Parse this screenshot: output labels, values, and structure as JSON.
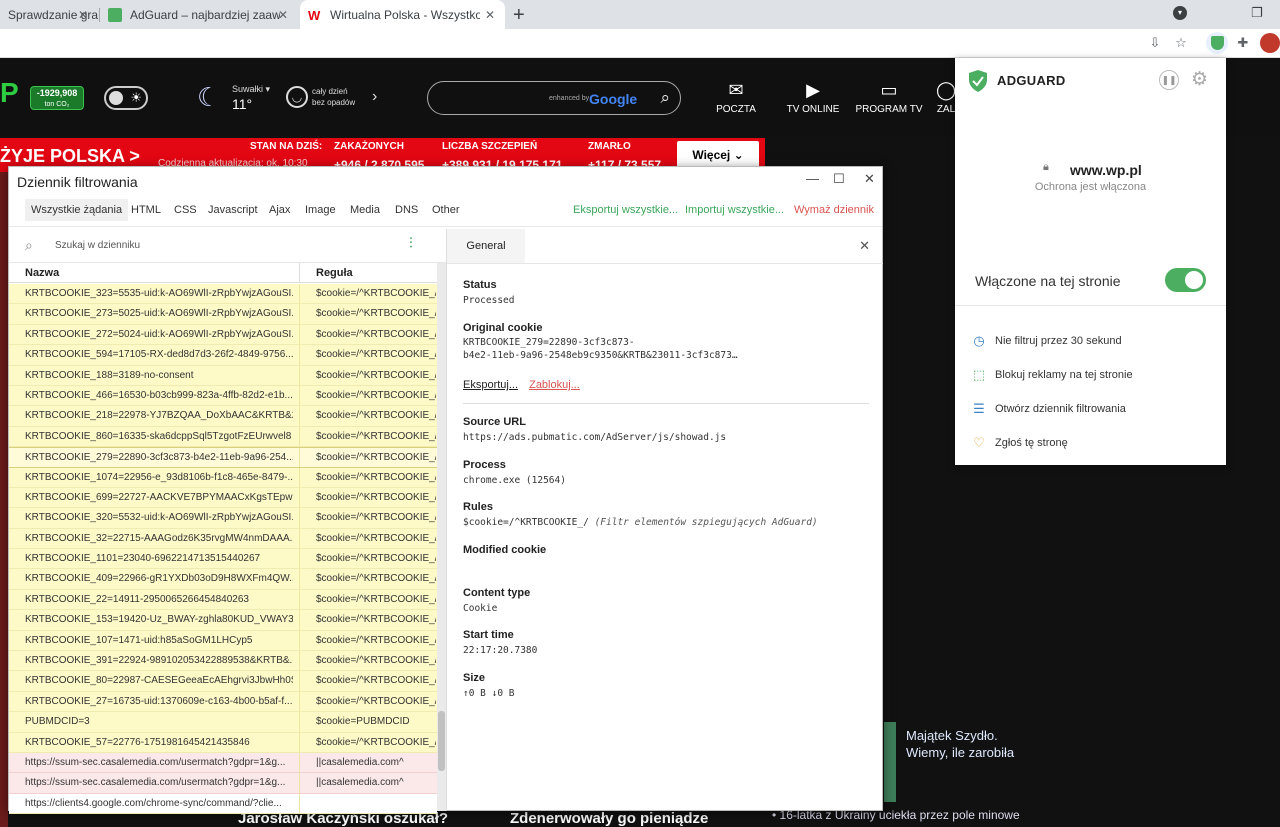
{
  "browser": {
    "tabs": [
      {
        "label": "Sprawdzanie gra",
        "active": false
      },
      {
        "label": "AdGuard – najbardziej zaawanso",
        "active": false
      },
      {
        "label": "Wirtualna Polska - Wszystko co w",
        "active": true
      }
    ],
    "new_tab": "+",
    "close_glyph": "✕"
  },
  "wp": {
    "co2_value": "-1929,908",
    "co2_unit": "ton CO₂",
    "weather_city": "Suwałki ▾",
    "weather_temp": "11°",
    "weather_desc_line1": "cały dzień",
    "weather_desc_line2": "bez opadów",
    "search_enhanced": "enhanced by",
    "search_brand": "Google",
    "nav": [
      {
        "icon": "✉",
        "label": "POCZTA"
      },
      {
        "icon": "▶",
        "label": "TV ONLINE"
      },
      {
        "icon": "▭",
        "label": "PROGRAM TV"
      },
      {
        "icon": "◯",
        "label": "ZAL"
      }
    ],
    "red_bar": {
      "title": "ŻYJE POLSKA >",
      "sub": "Codzienna aktualizacja: ok. 10:30",
      "stat1": "STAN NA DZIŚ:",
      "stat2": "ZAKAŻONYCH",
      "stat2_value": "+946 / 2 870 595",
      "stat3": "LICZBA SZCZEPIEŃ",
      "stat3_value": "+389 931 / 19 175 171",
      "stat4": "ZMARŁO",
      "stat4_value": "+117 / 73 557",
      "more_label": "Więcej ⌄"
    },
    "news_title_line1": "Majątek Szydło.",
    "news_title_line2": "Wiemy, ile zarobiła",
    "bullet": "• 16-latka z Ukrainy uciekła przez pole minowe",
    "bottom1": "Jarosław Kaczyński oszukał?",
    "bottom2": "Zdenerwowały go pieniądze"
  },
  "log": {
    "title": "Dziennik filtrowania",
    "win_controls": [
      "—",
      "☐",
      "✕"
    ],
    "tabs": [
      "Wszystkie żądania",
      "HTML",
      "CSS",
      "Javascript",
      "Ajax",
      "Image",
      "Media",
      "DNS",
      "Other"
    ],
    "actions": {
      "export_all": "Eksportuj wszystkie...",
      "import_all": "Importuj wszystkie...",
      "clear_log": "Wymaż dziennik"
    },
    "search_placeholder": "Szukaj w dzienniku",
    "col_name": "Nazwa",
    "col_rule": "Reguła",
    "rows": [
      {
        "name": "KRTBCOOKIE_323=5535-uid:k-AO69WlI-zRpbYwjzAGouSI...",
        "rule": "$cookie=/^KRTBCOOKIE_/",
        "kind": "yellow"
      },
      {
        "name": "KRTBCOOKIE_273=5025-uid:k-AO69WlI-zRpbYwjzAGouSI...",
        "rule": "$cookie=/^KRTBCOOKIE_/",
        "kind": "yellow"
      },
      {
        "name": "KRTBCOOKIE_272=5024-uid:k-AO69WlI-zRpbYwjzAGouSI...",
        "rule": "$cookie=/^KRTBCOOKIE_/",
        "kind": "yellow"
      },
      {
        "name": "KRTBCOOKIE_594=17105-RX-ded8d7d3-26f2-4849-9756...",
        "rule": "$cookie=/^KRTBCOOKIE_/",
        "kind": "yellow"
      },
      {
        "name": "KRTBCOOKIE_188=3189-no-consent",
        "rule": "$cookie=/^KRTBCOOKIE_/",
        "kind": "yellow"
      },
      {
        "name": "KRTBCOOKIE_466=16530-b03cb999-823a-4ffb-82d2-e1b...",
        "rule": "$cookie=/^KRTBCOOKIE_/",
        "kind": "yellow"
      },
      {
        "name": "KRTBCOOKIE_218=22978-YJ7BZQAA_DoXbAAC&KRTB&2...",
        "rule": "$cookie=/^KRTBCOOKIE_/",
        "kind": "yellow"
      },
      {
        "name": "KRTBCOOKIE_860=16335-ska6dcppSql5TzgotFzEUrwvel8",
        "rule": "$cookie=/^KRTBCOOKIE_/",
        "kind": "yellow"
      },
      {
        "name": "KRTBCOOKIE_279=22890-3cf3c873-b4e2-11eb-9a96-254...",
        "rule": "$cookie=/^KRTBCOOKIE_/",
        "kind": "sel"
      },
      {
        "name": "KRTBCOOKIE_1074=22956-e_93d8106b-f1c8-465e-8479-...",
        "rule": "$cookie=/^KRTBCOOKIE_/",
        "kind": "yellow"
      },
      {
        "name": "KRTBCOOKIE_699=22727-AACKVE7BPYMAACxKgsTEpw",
        "rule": "$cookie=/^KRTBCOOKIE_/",
        "kind": "yellow"
      },
      {
        "name": "KRTBCOOKIE_320=5532-uid:k-AO69WlI-zRpbYwjzAGouSI...",
        "rule": "$cookie=/^KRTBCOOKIE_/",
        "kind": "yellow"
      },
      {
        "name": "KRTBCOOKIE_32=22715-AAAGodz6K35rvgMW4nmDAAA...",
        "rule": "$cookie=/^KRTBCOOKIE_/",
        "kind": "yellow"
      },
      {
        "name": "KRTBCOOKIE_1101=23040-6962214713515440267",
        "rule": "$cookie=/^KRTBCOOKIE_/",
        "kind": "yellow"
      },
      {
        "name": "KRTBCOOKIE_409=22966-gR1YXDb03oD9H8WXFm4QW...",
        "rule": "$cookie=/^KRTBCOOKIE_/",
        "kind": "yellow"
      },
      {
        "name": "KRTBCOOKIE_22=14911-2950065266454840263",
        "rule": "$cookie=/^KRTBCOOKIE_/",
        "kind": "yellow"
      },
      {
        "name": "KRTBCOOKIE_153=19420-Uz_BWAY-zghla80KUD_VWAY3...",
        "rule": "$cookie=/^KRTBCOOKIE_/",
        "kind": "yellow"
      },
      {
        "name": "KRTBCOOKIE_107=1471-uid:h85aSoGM1LHCyp5",
        "rule": "$cookie=/^KRTBCOOKIE_/",
        "kind": "yellow"
      },
      {
        "name": "KRTBCOOKIE_391=22924-989102053422889538&KRTB&...",
        "rule": "$cookie=/^KRTBCOOKIE_/",
        "kind": "yellow"
      },
      {
        "name": "KRTBCOOKIE_80=22987-CAESEGeeaEcAEhgrvi3JbwHh0S...",
        "rule": "$cookie=/^KRTBCOOKIE_/",
        "kind": "yellow"
      },
      {
        "name": "KRTBCOOKIE_27=16735-uid:1370609e-c163-4b00-b5af-f...",
        "rule": "$cookie=/^KRTBCOOKIE_/",
        "kind": "yellow"
      },
      {
        "name": "PUBMDCID=3",
        "rule": "$cookie=PUBMDCID",
        "kind": "yellow"
      },
      {
        "name": "KRTBCOOKIE_57=22776-1751981645421435846",
        "rule": "$cookie=/^KRTBCOOKIE_/",
        "kind": "yellow"
      },
      {
        "name": "https://ssum-sec.casalemedia.com/usermatch?gdpr=1&g...",
        "rule": "||casalemedia.com^",
        "kind": "pink"
      },
      {
        "name": "https://ssum-sec.casalemedia.com/usermatch?gdpr=1&g...",
        "rule": "||casalemedia.com^",
        "kind": "pink"
      },
      {
        "name": "https://clients4.google.com/chrome-sync/command/?clie...",
        "rule": "",
        "kind": "white"
      }
    ],
    "detail": {
      "tab": "General",
      "status_label": "Status",
      "status_value": "Processed",
      "orig_label": "Original cookie",
      "orig_line1": "KRTBCOOKIE_279=22890-3cf3c873-",
      "orig_line2": "b4e2-11eb-9a96-2548eb9c9350&KRTB&23011-3cf3c873…",
      "export_link": "Eksportuj...",
      "block_link": "Zablokuj...",
      "source_label": "Source URL",
      "source_value": "https://ads.pubmatic.com/AdServer/js/showad.js",
      "process_label": "Process",
      "process_value": "chrome.exe (12564)",
      "rules_label": "Rules",
      "rules_value": "$cookie=/^KRTBCOOKIE_/",
      "rules_note": "(Filtr elementów szpiegujących AdGuard)",
      "modified_label": "Modified cookie",
      "ctype_label": "Content type",
      "ctype_value": "Cookie",
      "start_label": "Start time",
      "start_value": "22:17:20.7380",
      "size_label": "Size",
      "size_value": "↑0 B ↓0 B"
    }
  },
  "adguard": {
    "brand": "ADGUARD",
    "site": "www.wp.pl",
    "status": "Ochrona jest włączona",
    "toggle_label": "Włączone na tej stronie",
    "items": [
      {
        "icon": "clock-icon",
        "glyph": "◷",
        "label": "Nie filtruj przez 30 sekund"
      },
      {
        "icon": "block-ad-icon",
        "glyph": "⬚",
        "label": "Blokuj reklamy na tej stronie"
      },
      {
        "icon": "log-icon",
        "glyph": "☰",
        "label": "Otwórz dziennik filtrowania"
      },
      {
        "icon": "report-icon",
        "glyph": "♡",
        "label": "Zgłoś tę stronę"
      }
    ],
    "colors": {
      "green": "#4cae61",
      "blue": "#3b82c4",
      "orange": "#e6a23c"
    }
  }
}
